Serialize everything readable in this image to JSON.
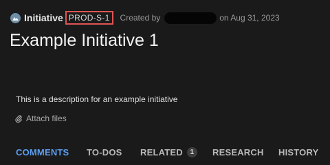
{
  "header": {
    "record_type": "Initiative",
    "type_icon": "initiative-icon",
    "reference_id": "PROD-S-1",
    "created_by_label": "Created by",
    "created_on": "on Aug 31, 2023"
  },
  "title": "Example Initiative 1",
  "description": "This is a description for an example initiative",
  "attachments": {
    "label": "Attach files",
    "icon": "paperclip-icon"
  },
  "tabs": [
    {
      "label": "COMMENTS",
      "active": true
    },
    {
      "label": "TO-DOS",
      "active": false
    },
    {
      "label": "RELATED",
      "active": false,
      "count": "1"
    },
    {
      "label": "RESEARCH",
      "active": false
    },
    {
      "label": "HISTORY",
      "active": false
    }
  ],
  "colors": {
    "background": "#1a1a1a",
    "active_tab": "#5b9ef0",
    "highlight_box": "#e05454",
    "icon_badge": "#6d8fa6"
  }
}
